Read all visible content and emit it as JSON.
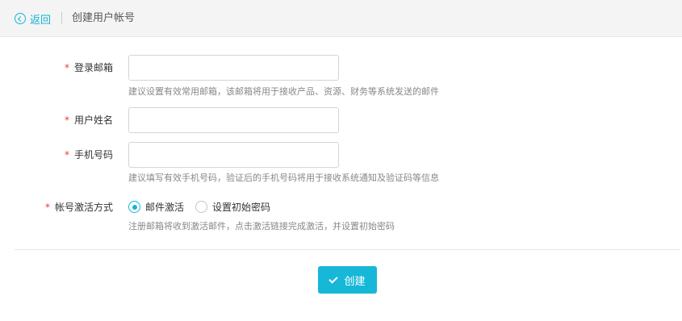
{
  "header": {
    "back_label": "返回",
    "title": "创建用户帐号"
  },
  "form": {
    "required_mark": "*",
    "email": {
      "label": "登录邮箱",
      "value": "",
      "placeholder": "",
      "hint": "建议设置有效常用邮箱，该邮箱将用于接收产品、资源、财务等系统发送的邮件"
    },
    "username": {
      "label": "用户姓名",
      "value": "",
      "placeholder": ""
    },
    "phone": {
      "label": "手机号码",
      "value": "",
      "placeholder": "",
      "hint": "建议填写有效手机号码，验证后的手机号码将用于接收系统通知及验证码等信息"
    },
    "activation": {
      "label": "帐号激活方式",
      "options": [
        {
          "label": "邮件激活",
          "checked": true
        },
        {
          "label": "设置初始密码",
          "checked": false
        }
      ],
      "hint": "注册邮箱将收到激活邮件，点击激活链接完成激活，并设置初始密码"
    }
  },
  "actions": {
    "create_label": "创建"
  },
  "colors": {
    "accent": "#13b5d3",
    "button": "#17b7d8",
    "required": "#e4393c",
    "hint_text": "#888888"
  },
  "icons": {
    "back": "back-circle-icon",
    "create": "check-icon"
  }
}
